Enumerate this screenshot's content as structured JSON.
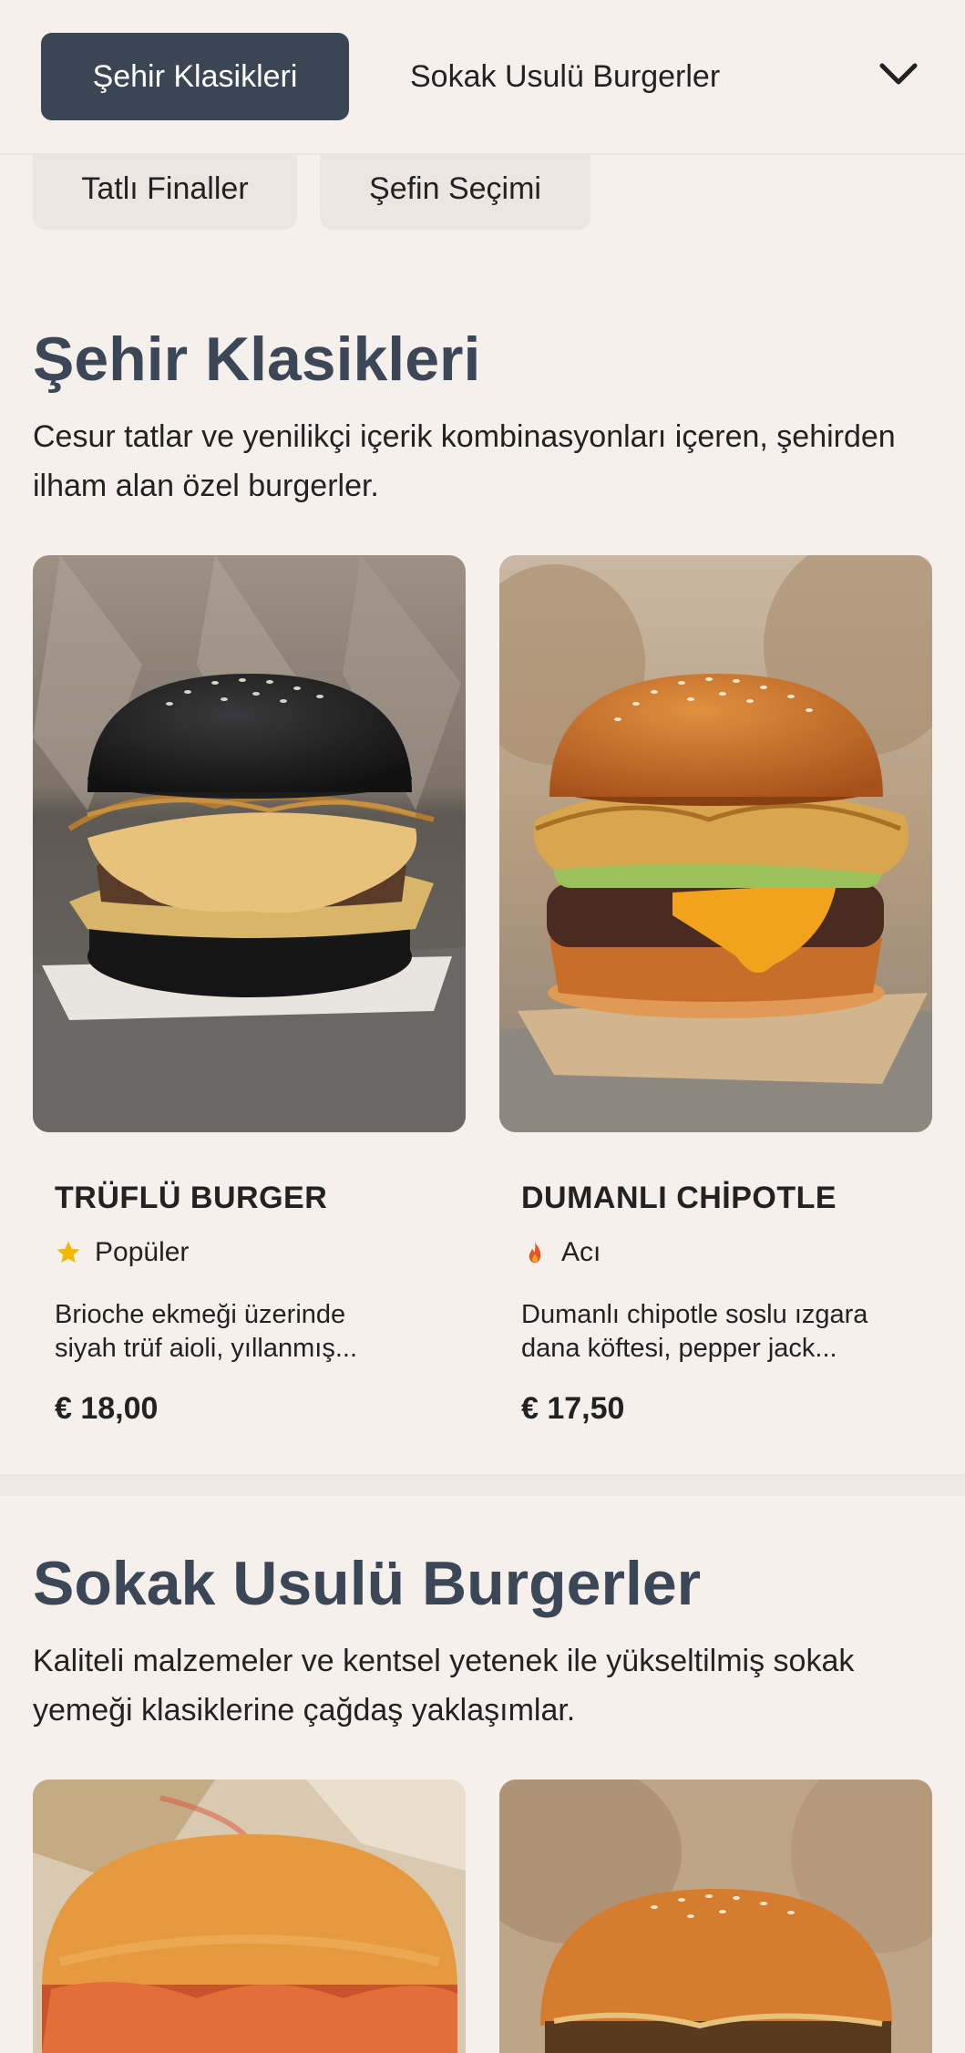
{
  "nav": {
    "active_tab": "Şehir Klasikleri",
    "tab_2": "Sokak Usulü Burgerler",
    "tab_3": "Tatlı Finaller",
    "tab_4": "Şefin Seçimi",
    "chevron_icon": "chevron-down-icon"
  },
  "sections": [
    {
      "title": "Şehir Klasikleri",
      "description": "Cesur tatlar ve yenilikçi içerik kombinasyonları içeren, şehirden ilham alan özel burgerler.",
      "items": [
        {
          "name": "TRÜFLÜ BURGER",
          "tag": "Popüler",
          "tag_icon": "star-icon",
          "tag_color": "#f5b800",
          "description_line1": "Brioche ekmeği üzerinde",
          "description_line2": "siyah trüf aioli, yıllanmış...",
          "price": "€ 18,00"
        },
        {
          "name": "DUMANLI CHİPOTLE",
          "tag": "Acı",
          "tag_icon": "flame-icon",
          "tag_color": "#e8531f",
          "description_line1": "Dumanlı chipotle soslu ızgara",
          "description_line2": "dana köftesi, pepper jack...",
          "price": "€ 17,50"
        }
      ]
    },
    {
      "title": "Sokak Usulü Burgerler",
      "description": "Kaliteli malzemeler ve kentsel yetenek ile yükseltilmiş sokak yemeği klasiklerine çağdaş yaklaşımlar."
    }
  ],
  "colors": {
    "background": "#f5f0ec",
    "accent": "#3a4654",
    "heading": "#3b4756"
  }
}
